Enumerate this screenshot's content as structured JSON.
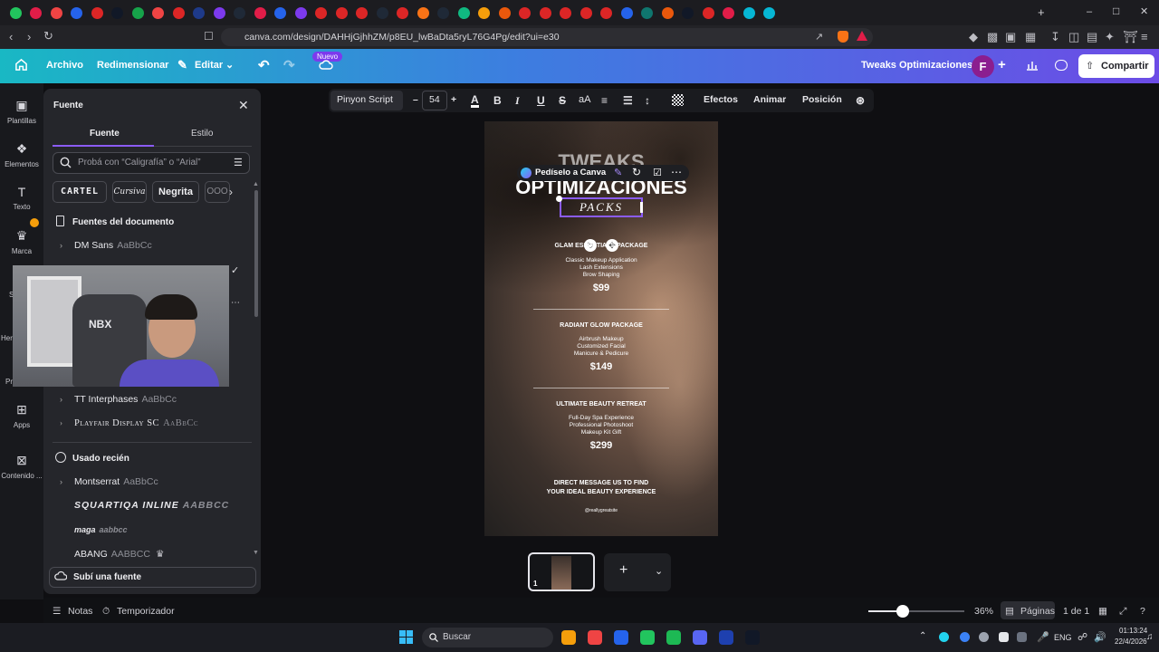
{
  "browser": {
    "tab_colors": [
      "#22c55e",
      "#e11d48",
      "#ef4444",
      "#2563eb",
      "#dc2626",
      "#111827",
      "#16a34a",
      "#ef4444",
      "#dc2626",
      "#1e3a8a",
      "#7c3aed",
      "#1f2937",
      "#e11d48",
      "#2563eb",
      "#7c3aed",
      "#dc2626",
      "#dc2626",
      "#dc2626",
      "#1f2937",
      "#dc2626",
      "#f97316",
      "#1f2937",
      "#10b981",
      "#f59e0b",
      "#ea580c",
      "#dc2626",
      "#dc2626",
      "#dc2626",
      "#dc2626",
      "#dc2626",
      "#2563eb",
      "#0f766e",
      "#ea580c",
      "#111827",
      "#dc2626",
      "#e11d48",
      "#06b6d4",
      "#06b6d4"
    ],
    "url": "canva.com/design/DAHHjGjhhZM/p8EU_lwBaDta5ryL76G4Pg/edit?ui=e30",
    "new_tab_symbol": "+",
    "window_controls": [
      "‒",
      "□",
      "✕"
    ]
  },
  "canva_header": {
    "file": "Archivo",
    "resize": "Redimensionar",
    "edit": "Editar",
    "new_badge": "Nuevo",
    "title": "Tweaks Optimizaciones",
    "avatar_letter": "F",
    "share": "Compartir"
  },
  "rail": {
    "items": [
      {
        "label": "Plantillas",
        "icon": "▣"
      },
      {
        "label": "Elementos",
        "icon": "❖"
      },
      {
        "label": "Texto",
        "icon": "T"
      },
      {
        "label": "Marca",
        "icon": "♛"
      },
      {
        "label": "Apps",
        "icon": "⊞"
      },
      {
        "label": "Contenido ...",
        "icon": "⊠"
      }
    ],
    "partial_labels": [
      "S",
      "Her",
      "Pr"
    ]
  },
  "font_panel": {
    "title": "Fuente",
    "tab_font": "Fuente",
    "tab_style": "Estilo",
    "search_placeholder": "Probá con “Caligrafía” o “Arial”",
    "chips": [
      "CARTEL",
      "Cursiva",
      "Negrita",
      "OOO"
    ],
    "document_fonts_heading": "Fuentes del documento",
    "document_fonts": [
      {
        "name": "DM Sans",
        "sample": "AaBbCc"
      },
      {
        "name": "TT Interphases",
        "sample": "AaBbCc"
      },
      {
        "name": "Playfair Display SC",
        "sample": "AaBbCc"
      }
    ],
    "recent_heading": "Usado recién",
    "recent_fonts": [
      {
        "name": "Montserrat",
        "sample": "AaBbCc"
      },
      {
        "name": "SQUARTIQA INLINE",
        "sample": "AABBCC"
      },
      {
        "name": "maga",
        "sample": "aabbcc"
      },
      {
        "name": "ABANG",
        "sample": "AABBCC"
      }
    ],
    "upload": "Subí una fuente",
    "webcam_text": "NBX"
  },
  "text_toolbar": {
    "font": "Pinyon Script",
    "minus": "–",
    "size": "54",
    "plus": "+",
    "effects": "Efectos",
    "animate": "Animar",
    "position": "Posición"
  },
  "design": {
    "title_top": "TWEAKS",
    "title_main": "OPTIMIZACIONES",
    "selected_text": "PACKS",
    "selection_toolbar": "Pedíselo a Canva",
    "packages": [
      {
        "name": "GLAM ESSENTIALS PACKAGE",
        "items": [
          "Classic Makeup Application",
          "Lash Extensions",
          "Brow Shaping"
        ],
        "price": "$99"
      },
      {
        "name": "RADIANT GLOW PACKAGE",
        "items": [
          "Airbrush Makeup",
          "Customized Facial",
          "Manicure & Pedicure"
        ],
        "price": "$149"
      },
      {
        "name": "ULTIMATE BEAUTY RETREAT",
        "items": [
          "Full-Day Spa Experience",
          "Professional Photoshoot",
          "Makeup Kit Gift"
        ],
        "price": "$299"
      }
    ],
    "cta_line1": "DIRECT MESSAGE US TO FIND",
    "cta_line2": "YOUR IDEAL BEAUTY EXPERIENCE",
    "handle": "@reallygreatsite"
  },
  "bottom_bar": {
    "notes": "Notas",
    "timer": "Temporizador",
    "zoom": "36%",
    "pages": "Páginas",
    "page_count": "1 de 1",
    "page_number": "1",
    "add_page": "+"
  },
  "taskbar": {
    "search": "Buscar",
    "lang": "ENG",
    "time": "01:13:24",
    "date": "22/4/2026",
    "icon_colors": [
      "#f59e0b",
      "#ef4444",
      "#2563eb",
      "#22c55e",
      "#1db954",
      "#5865f2",
      "#1e40af",
      "#111827"
    ]
  }
}
